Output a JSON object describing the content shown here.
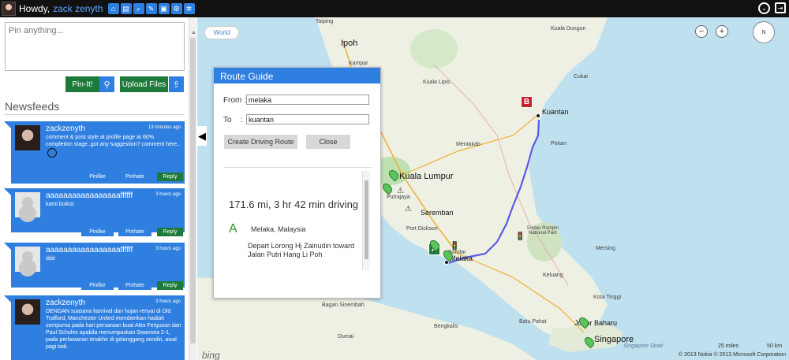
{
  "topbar": {
    "greeting": "Howdy,",
    "username": "zack zenyth",
    "icons": [
      "home-icon",
      "chat-icon",
      "search-icon",
      "edit-icon",
      "gallery-icon",
      "settings-icon",
      "gear-icon"
    ],
    "right_icons": [
      "chevron-down-icon",
      "logout-icon"
    ]
  },
  "composer": {
    "placeholder": "Pin anything...",
    "pin_button": "Pin-It!",
    "upload_button": "Upload Files"
  },
  "newsfeeds": {
    "title": "Newsfeeds",
    "actions": {
      "like": "Pinlike",
      "hate": "Pinhate",
      "reply": "Reply"
    },
    "items": [
      {
        "name": "zackzenyth",
        "time": "13 minutes ago",
        "body": "comment & post style at profile page at 60% completion stage..got any suggestion? comment here.."
      },
      {
        "name": "aaaaaaaaaaaaaaaaaffffff",
        "time": "3 hours ago",
        "body": "kami boikot"
      },
      {
        "name": "aaaaaaaaaaaaaaaaaffffff",
        "time": "3 hours ago",
        "body": "ddd"
      },
      {
        "name": "zackzenyth",
        "time": "3 hours ago",
        "body": "DENGAN suasana karnival dan hujan renyai di Old Trafford, Manchester United memberikan hadiah sempurna pada hari persaraan buat Alex Ferguson dan Paul Scholes apabila menumpaskan Swansea 2-1, pada perlawanan terakhir di gelanggang sendiri, awal pagi tadi."
      }
    ]
  },
  "map": {
    "world_button": "World",
    "zoom_out": "−",
    "zoom_in": "+",
    "compass": "N",
    "labels": {
      "taiping": "Taiping",
      "ipoh": "Ipoh",
      "kampar": "Kampar",
      "kuala_dungun": "Kuala Dungun",
      "cukai": "Cukai",
      "kuala_lipis": "Kuala Lipis",
      "kuantan": "Kuantan",
      "mentakab": "Mentakab",
      "pekan": "Pekan",
      "kuala_lumpur": "Kuala Lumpur",
      "putrajaya": "Putrajaya",
      "seremban": "Seremban",
      "port_dickson": "Port Dickson",
      "bandar": "Bandar",
      "melaka": "Melaka",
      "endau_rompin": "Endau Rompin National Park",
      "mersing": "Mersing",
      "keluang": "Keluang",
      "bagan_sinembah": "Bagan Sinembah",
      "batu_pahat": "Batu Pahat",
      "bengkalis": "Bengkalis",
      "johor_bahru": "Johor Baharu",
      "singapore": "Singapore",
      "singapore_strait": "Singapore Strait",
      "dumai": "Dumai",
      "kota_tinggi": "Kota Tinggi"
    },
    "scale_miles": "25 miles",
    "scale_km": "50 km",
    "copyright": "© 2013 Nokia   © 2013 Microsoft Corporation",
    "brand": "bing"
  },
  "route_guide": {
    "title": "Route Guide",
    "from_label": "From :",
    "from_value": "melaka",
    "to_label": "To",
    "to_colon": ":",
    "to_value": "kuantan",
    "create_button": "Create Driving Route",
    "close_button": "Close",
    "summary": "171.6 mi, 3 hr 42 min driving",
    "waypoint_letter": "A",
    "waypoint_name": "Melaka, Malaysia",
    "step": "Depart Lorong Hj Zainudin toward Jalan Putri Hang Li Poh"
  },
  "colors": {
    "accent": "#2f7fe0",
    "green": "#1e7a3a",
    "route": "#5a5ae6"
  }
}
